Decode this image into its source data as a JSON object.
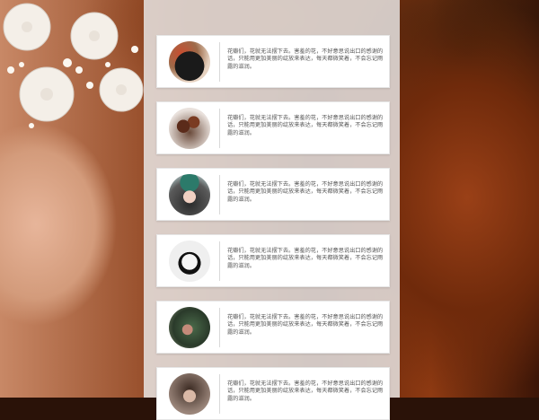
{
  "feed": {
    "items": [
      {
        "avatar_icon": "avatar-silhouette",
        "text": "花瓣们，花就无法摆下去。害羞的花，不好意思说出口的感谢的话，只能用更加美丽的绽放来表达，每天都微笑着，不会忘记雨露的滋润。"
      },
      {
        "avatar_icon": "avatar-roses",
        "text": "花瓣们，花就无法摆下去。害羞的花，不好意思说出口的感谢的话，只能用更加美丽的绽放来表达，每天都微笑着，不会忘记雨露的滋润。"
      },
      {
        "avatar_icon": "avatar-flower-crown",
        "text": "花瓣们，花就无法摆下去。害羞的花，不好意思说出口的感谢的话，只能用更加美丽的绽放来表达，每天都微笑着，不会忘记雨露的滋润。"
      },
      {
        "avatar_icon": "avatar-bw-portrait",
        "text": "花瓣们，花就无法摆下去。害羞的花，不好意思说出口的感谢的话，只能用更加美丽的绽放来表达，每天都微笑着，不会忘记雨露的滋润。"
      },
      {
        "avatar_icon": "avatar-portrait",
        "text": "花瓣们，花就无法摆下去。害羞的花，不好意思说出口的感谢的话，只能用更加美丽的绽放来表达，每天都微笑着，不会忘记雨露的滋润。"
      },
      {
        "avatar_icon": "avatar-portrait-2",
        "text": "花瓣们，花就无法摆下去。害羞的花，不好意思说出口的感谢的话，只能用更加美丽的绽放来表达，每天都微笑着，不会忘记雨露的滋润。"
      }
    ]
  }
}
